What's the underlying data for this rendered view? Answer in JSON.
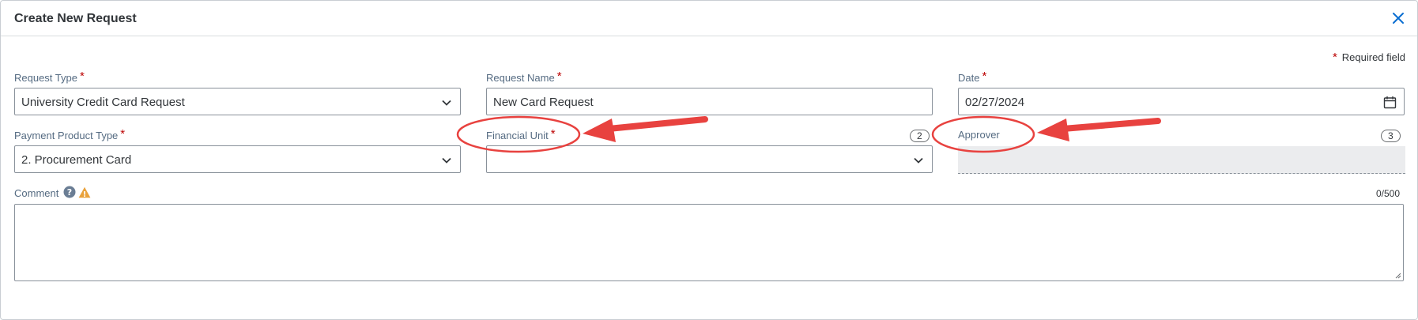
{
  "dialog": {
    "title": "Create New Request",
    "close_icon": "close-icon"
  },
  "required_note": {
    "star": "*",
    "text": "Required field"
  },
  "form": {
    "request_type": {
      "label": "Request Type",
      "star": "*",
      "value": "University Credit Card Request",
      "icon": "chevron-down-icon"
    },
    "request_name": {
      "label": "Request Name",
      "star": "*",
      "value": "New Card Request"
    },
    "date": {
      "label": "Date",
      "star": "*",
      "value": "02/27/2024",
      "icon": "calendar-icon"
    },
    "payment_product_type": {
      "label": "Payment Product Type",
      "star": "*",
      "value": "2. Procurement Card",
      "icon": "chevron-down-icon"
    },
    "financial_unit": {
      "label": "Financial Unit",
      "star": "*",
      "value": "",
      "count": "2",
      "icon": "chevron-down-icon"
    },
    "approver": {
      "label": "Approver",
      "value": "",
      "count": "3"
    },
    "comment": {
      "label": "Comment",
      "char_count": "0/500",
      "help_icon": "help-icon",
      "warning_icon": "warning-icon"
    }
  },
  "colors": {
    "required_star": "#bb0000",
    "label": "#556b82",
    "close_icon": "#0a6ed1",
    "annotation": "#e8423f"
  }
}
